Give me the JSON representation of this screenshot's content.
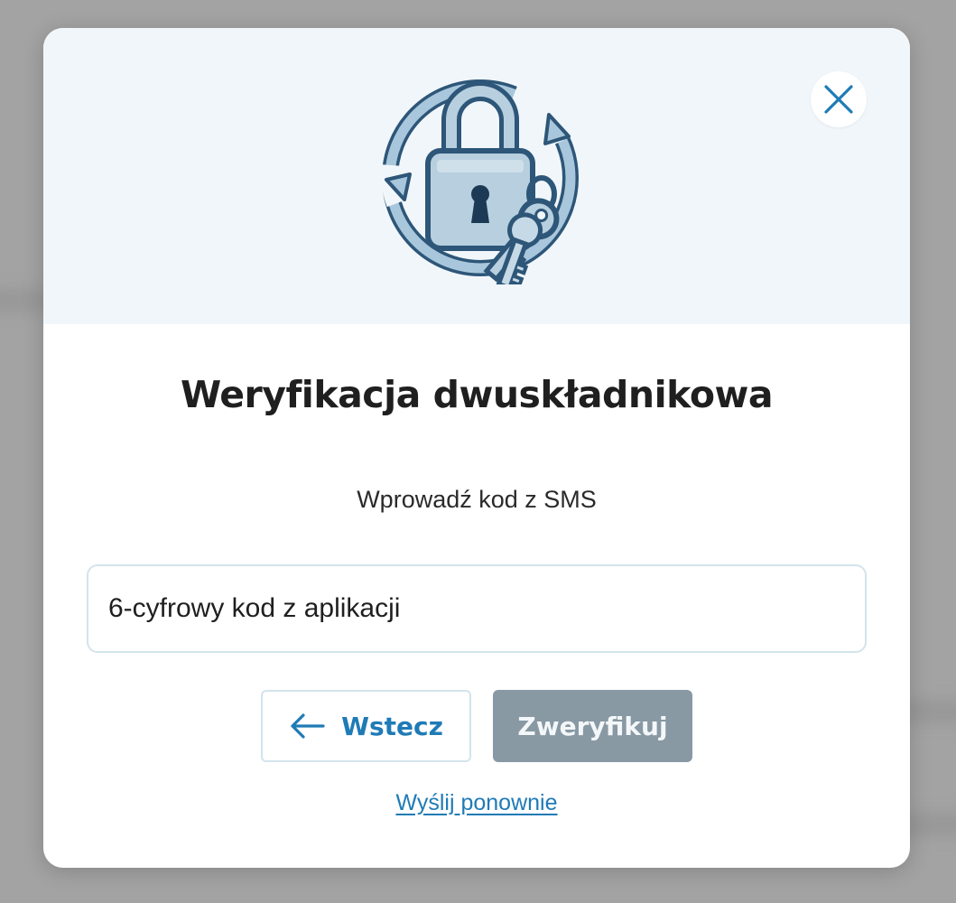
{
  "modal": {
    "title": "Weryfikacja dwuskładnikowa",
    "subtitle": "Wprowadź kod z SMS",
    "close_icon": "close-icon",
    "illustration_icon": "padlock-keys-icon"
  },
  "code_input": {
    "value": "",
    "placeholder": "6-cyfrowy kod z aplikacji"
  },
  "buttons": {
    "back_label": "Wstecz",
    "back_icon": "arrow-left-icon",
    "verify_label": "Zweryfikuj"
  },
  "resend_link": "Wyślij ponownie",
  "colors": {
    "accent": "#1f7bb6",
    "verify_disabled_bg": "#8899a4",
    "header_bg": "#f1f6fa",
    "overlay_bg": "#a3a3a3"
  }
}
